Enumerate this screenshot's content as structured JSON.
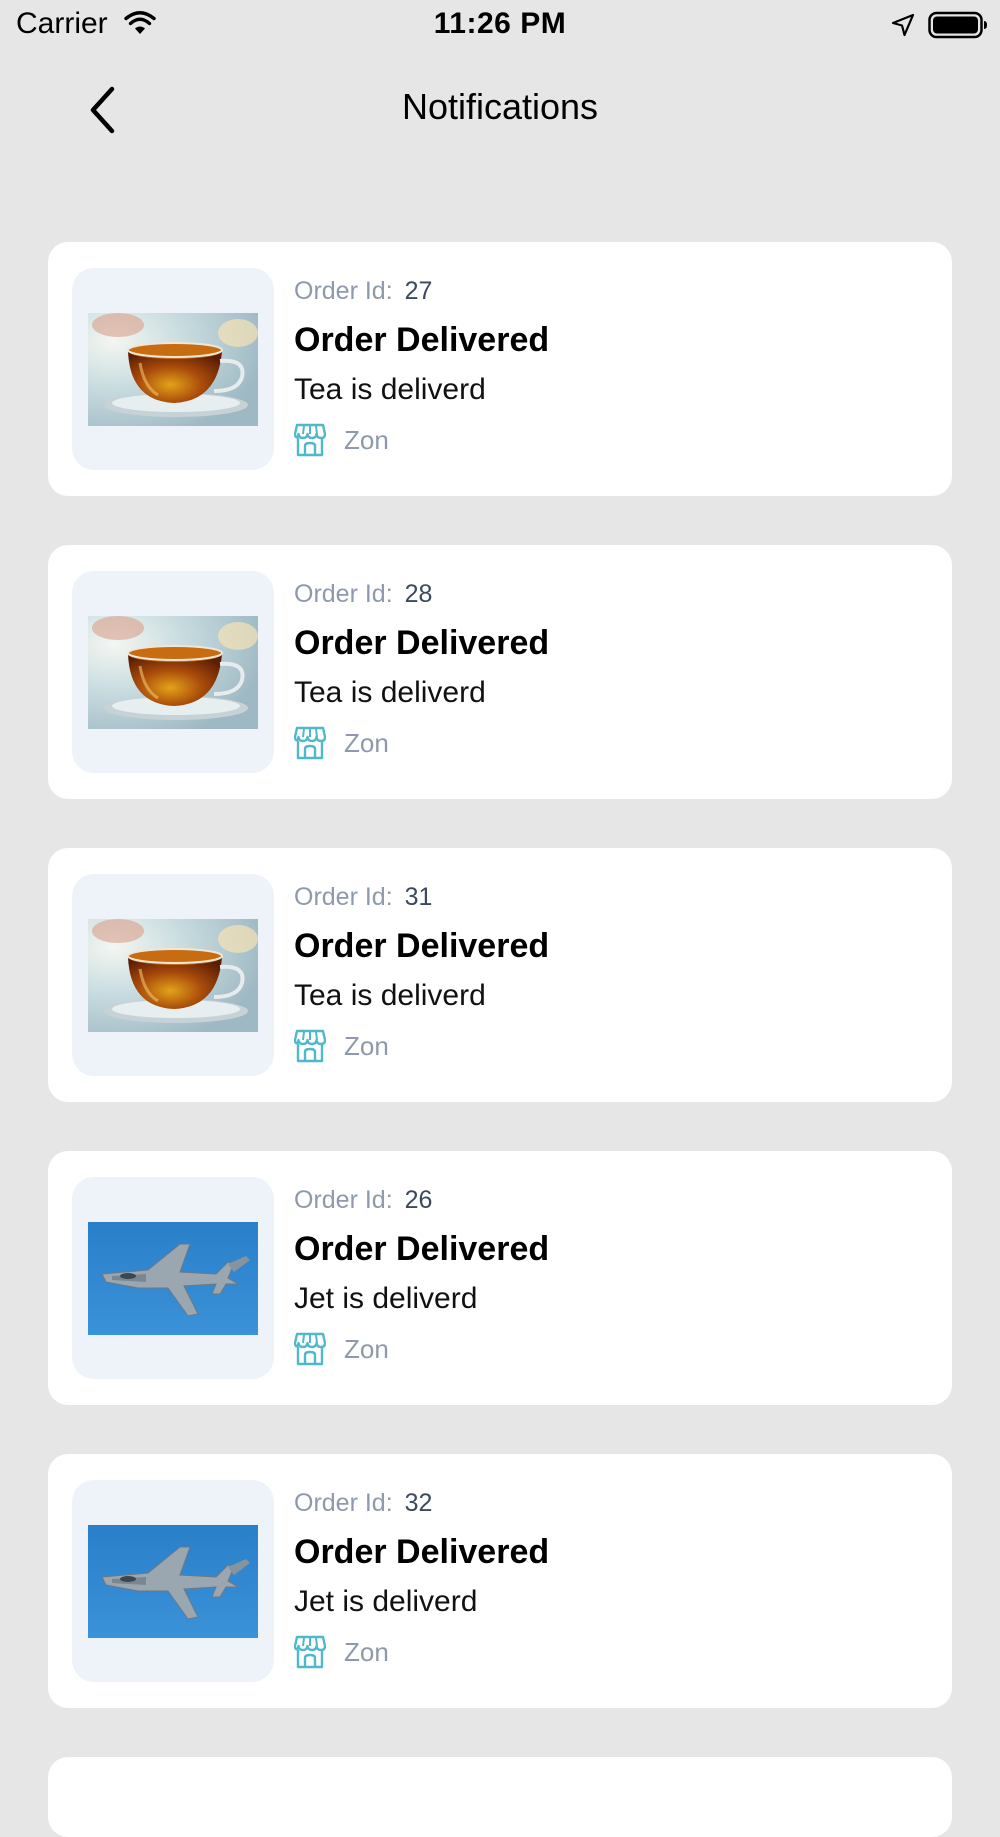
{
  "status_bar": {
    "carrier": "Carrier",
    "time": "11:26 PM"
  },
  "header": {
    "title": "Notifications"
  },
  "notifications": [
    {
      "order_label": "Order Id:",
      "order_id": "27",
      "title": "Order Delivered",
      "message": "Tea is deliverd",
      "store": "Zon",
      "image": "tea-cup-image"
    },
    {
      "order_label": "Order Id:",
      "order_id": "28",
      "title": "Order Delivered",
      "message": "Tea is deliverd",
      "store": "Zon",
      "image": "tea-cup-image"
    },
    {
      "order_label": "Order Id:",
      "order_id": "31",
      "title": "Order Delivered",
      "message": "Tea is deliverd",
      "store": "Zon",
      "image": "tea-cup-image"
    },
    {
      "order_label": "Order Id:",
      "order_id": "26",
      "title": "Order Delivered",
      "message": "Jet is deliverd",
      "store": "Zon",
      "image": "fighter-jet-image"
    },
    {
      "order_label": "Order Id:",
      "order_id": "32",
      "title": "Order Delivered",
      "message": "Jet is deliverd",
      "store": "Zon",
      "image": "fighter-jet-image"
    }
  ],
  "colors": {
    "background": "#e6e6e6",
    "card": "#ffffff",
    "thumb_background": "#eef2f9",
    "muted_text": "#8e9aab",
    "store_icon": "#4fb8c9"
  },
  "icons": {
    "back": "chevron-left-icon",
    "store": "store-icon",
    "wifi": "wifi-icon",
    "location": "location-arrow-icon",
    "battery": "battery-icon"
  }
}
